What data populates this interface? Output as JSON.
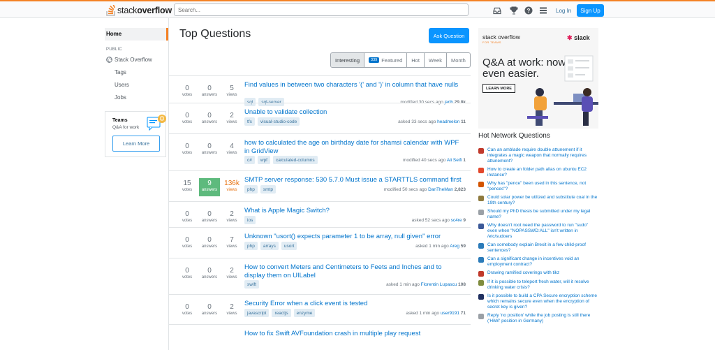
{
  "header": {
    "logo_text_1": "stack",
    "logo_text_2": "overflow",
    "search_placeholder": "Search...",
    "login": "Log In",
    "signup": "Sign Up"
  },
  "leftnav": {
    "home": "Home",
    "section": "PUBLIC",
    "stackoverflow": "Stack Overflow",
    "tags": "Tags",
    "users": "Users",
    "jobs": "Jobs",
    "teams_title": "Teams",
    "teams_sub": "Q&A for work",
    "learn_more": "Learn More"
  },
  "main": {
    "title": "Top Questions",
    "ask": "Ask Question",
    "featured_count": "339",
    "filters": [
      "Interesting",
      "Featured",
      "Hot",
      "Week",
      "Month"
    ],
    "stat_labels": {
      "votes": "votes",
      "answers": "answers",
      "views": "views"
    },
    "questions": [
      {
        "votes": "0",
        "answers": "0",
        "views": "5",
        "title": "Find values in between two characters '(' and ')' in column that have nulls",
        "tags": [
          "sql",
          "sql-server"
        ],
        "meta": "modified 30 secs ago",
        "user": "jarlh",
        "rep": "29.8k"
      },
      {
        "votes": "0",
        "answers": "0",
        "views": "2",
        "title": "Unable to validate collection",
        "tags": [
          "tfs",
          "visual-studio-code"
        ],
        "meta": "asked 33 secs ago",
        "user": "headmelon",
        "rep": "11"
      },
      {
        "votes": "0",
        "answers": "0",
        "views": "4",
        "title": "how to calculated the age on birthday date for shamsi calendar with WPF in GridView",
        "tags": [
          "c#",
          "wpf",
          "calculated-columns"
        ],
        "meta": "modified 40 secs ago",
        "user": "Ali Seifi",
        "rep": "1"
      },
      {
        "votes": "15",
        "answers": "9",
        "views": "136k",
        "title": "SMTP server response: 530 5.7.0 Must issue a STARTTLS command first",
        "tags": [
          "php",
          "smtp"
        ],
        "meta": "modified 50 secs ago",
        "user": "DanTheMan",
        "rep": "2,823"
      },
      {
        "votes": "0",
        "answers": "0",
        "views": "2",
        "title": "What is Apple Magic Switch?",
        "tags": [
          "ios"
        ],
        "meta": "asked 52 secs ago",
        "user": "sc4re",
        "rep": "9"
      },
      {
        "votes": "0",
        "answers": "0",
        "views": "7",
        "title": "Unknown \"usort() expects parameter 1 to be array, null given\" error",
        "tags": [
          "php",
          "arrays",
          "usort"
        ],
        "meta": "asked 1 min ago",
        "user": "Areg",
        "rep": "59"
      },
      {
        "votes": "0",
        "answers": "0",
        "views": "2",
        "title": "How to convert Meters and Centimeters to Feets and Inches and to display them on UILabel",
        "tags": [
          "swift"
        ],
        "meta": "asked 1 min ago",
        "user": "Florentin Lupascu",
        "rep": "108"
      },
      {
        "votes": "0",
        "answers": "0",
        "views": "2",
        "title": "Security Error when a click event is tested",
        "tags": [
          "javascript",
          "reactjs",
          "enzyme"
        ],
        "meta": "asked 1 min ago",
        "user": "user9191",
        "rep": "71"
      },
      {
        "votes": "",
        "answers": "",
        "views": "",
        "title": "How to fix Swift AVFoundation crash in multiple play request",
        "tags": [],
        "meta": "",
        "user": "",
        "rep": ""
      }
    ]
  },
  "sidebar": {
    "ad_logo": "stack overflow",
    "ad_logo_sub": "FOR TEAMS",
    "ad_slack": "slack",
    "ad_head": "Q&A at work: now even easier.",
    "ad_btn": "LEARN MORE",
    "hnq_title": "Hot Network Questions",
    "hnq": [
      {
        "text": "Can an amblade require double attunement if it integrates a magic weapon that normally requires attunement?",
        "color": "#c0392b"
      },
      {
        "text": "How to create an folder path alias on ubuntu EC2 instance?",
        "color": "#e2472b"
      },
      {
        "text": "Why has \"pence\" been used in this sentence, not \"pences\"?",
        "color": "#d35400"
      },
      {
        "text": "Could solar power be utilized and substitute coal in the 19th century?",
        "color": "#8e7a3e"
      },
      {
        "text": "Should my PhD thesis be submitted under my legal name?",
        "color": "#9aa0a6"
      },
      {
        "text": "Why doesn't root need the password to run \"sudo\" even when \"NOPASSWD:ALL\" isn't written in /etc/sudoers",
        "color": "#3b5998"
      },
      {
        "text": "Can somebody explain Brexit in a few child-proof sentences?",
        "color": "#2b7bb9"
      },
      {
        "text": "Can a significant change in incentives void an employment contract?",
        "color": "#2b7bb9"
      },
      {
        "text": "Drawing ramified coverings with tikz",
        "color": "#c0392b"
      },
      {
        "text": "If it is possible to teleport fresh water, will it resolve drinking water crisis?",
        "color": "#7f8c3e"
      },
      {
        "text": "Is it possible to build a CPA Secure encryption scheme which remains secure even when the encryption of secret key is given?",
        "color": "#1f2f5f"
      },
      {
        "text": "Reply 'no position' while the job posting is still there ('HiWi' position in Germany)",
        "color": "#9aa0a6"
      }
    ]
  }
}
